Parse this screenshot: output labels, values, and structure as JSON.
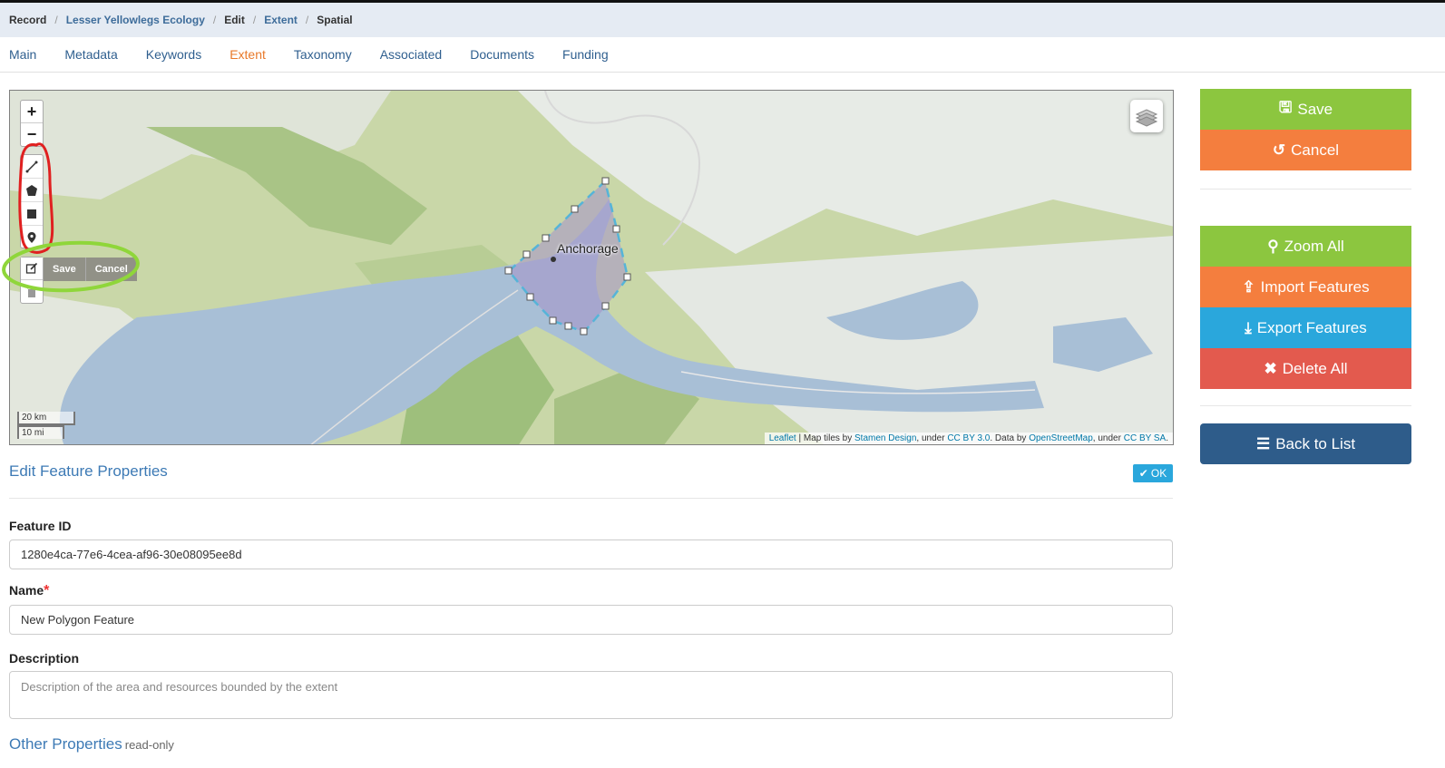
{
  "breadcrumb": [
    "Record",
    "Lesser Yellowlegs Ecology",
    "Edit",
    "Extent",
    "Spatial"
  ],
  "tabs": [
    {
      "label": "Main"
    },
    {
      "label": "Metadata"
    },
    {
      "label": "Keywords"
    },
    {
      "label": "Extent",
      "active": true
    },
    {
      "label": "Taxonomy"
    },
    {
      "label": "Associated"
    },
    {
      "label": "Documents"
    },
    {
      "label": "Funding"
    }
  ],
  "map": {
    "zoom_in": "+",
    "zoom_out": "−",
    "draw_tools": [
      "polyline-icon",
      "polygon-icon",
      "rectangle-icon",
      "marker-icon"
    ],
    "edit_actions": {
      "save": "Save",
      "cancel": "Cancel"
    },
    "place_label": "Anchorage",
    "scale": {
      "km": "20 km",
      "mi": "10 mi"
    },
    "attribution": {
      "leaflet": "Leaflet",
      "text1": " | Map tiles by ",
      "stamen": "Stamen Design",
      "text2": ", under ",
      "ccby": "CC BY 3.0",
      "text3": ". Data by ",
      "osm": "OpenStreetMap",
      "text4": ", under ",
      "ccbysa": "CC BY SA",
      "text5": "."
    }
  },
  "sidebar": {
    "save": "Save",
    "cancel": "Cancel",
    "zoom_all": "Zoom All",
    "import": "Import Features",
    "export": "Export Features",
    "delete_all": "Delete All",
    "back": "Back to List"
  },
  "properties": {
    "title": "Edit Feature Properties",
    "ok": "OK",
    "feature_id_label": "Feature ID",
    "feature_id": "1280e4ca-77e6-4cea-af96-30e08095ee8d",
    "name_label": "Name",
    "required_mark": "*",
    "name": "New Polygon Feature",
    "description_label": "Description",
    "description_placeholder": "Description of the area and resources bounded by the extent",
    "other_title": "Other Properties",
    "other_note": "read-only"
  },
  "colors": {
    "accent": "#e8792a",
    "link": "#3d7ab5",
    "save": "#8cc63f",
    "cancel": "#f47e3e",
    "export": "#2aa7dc",
    "delete": "#e35a4e",
    "back": "#2e5c8a"
  }
}
